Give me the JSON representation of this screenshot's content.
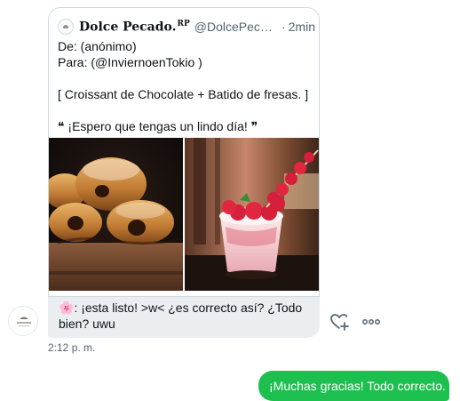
{
  "colors": {
    "received_bubble": "#ebeef0",
    "sent_bubble": "#1dbf4f",
    "muted_text": "#536471",
    "border": "#cfd9de"
  },
  "quoted_tweet": {
    "display_name": "Dolce Pecado.",
    "rp_badge": "RP",
    "handle": "@DolcePecadoC...",
    "separator": "·",
    "time": "2min",
    "lines": [
      "De: (anónimo)",
      "Para: (@InviernoenTokio )",
      "",
      "[ Croissant de Chocolate + Batido de fresas. ]",
      "",
      "❝ ¡Espero que tengas un lindo día! ❞"
    ],
    "images": [
      {
        "icon": "chocolate-croissant-photo"
      },
      {
        "icon": "strawberry-milkshake-photo"
      }
    ]
  },
  "received_message": {
    "emoji": "🌸",
    "line1": ": ¡esta listo! >w< ¿es correcto así? ¿Todo",
    "line2": "bien? uwu",
    "timestamp": "2:12 p. m.",
    "actions": {
      "like_icon": "heart-plus-icon",
      "more_icon": "more-dots-icon"
    }
  },
  "sent_message": {
    "text": "¡Muchas gracias! Todo correcto."
  }
}
